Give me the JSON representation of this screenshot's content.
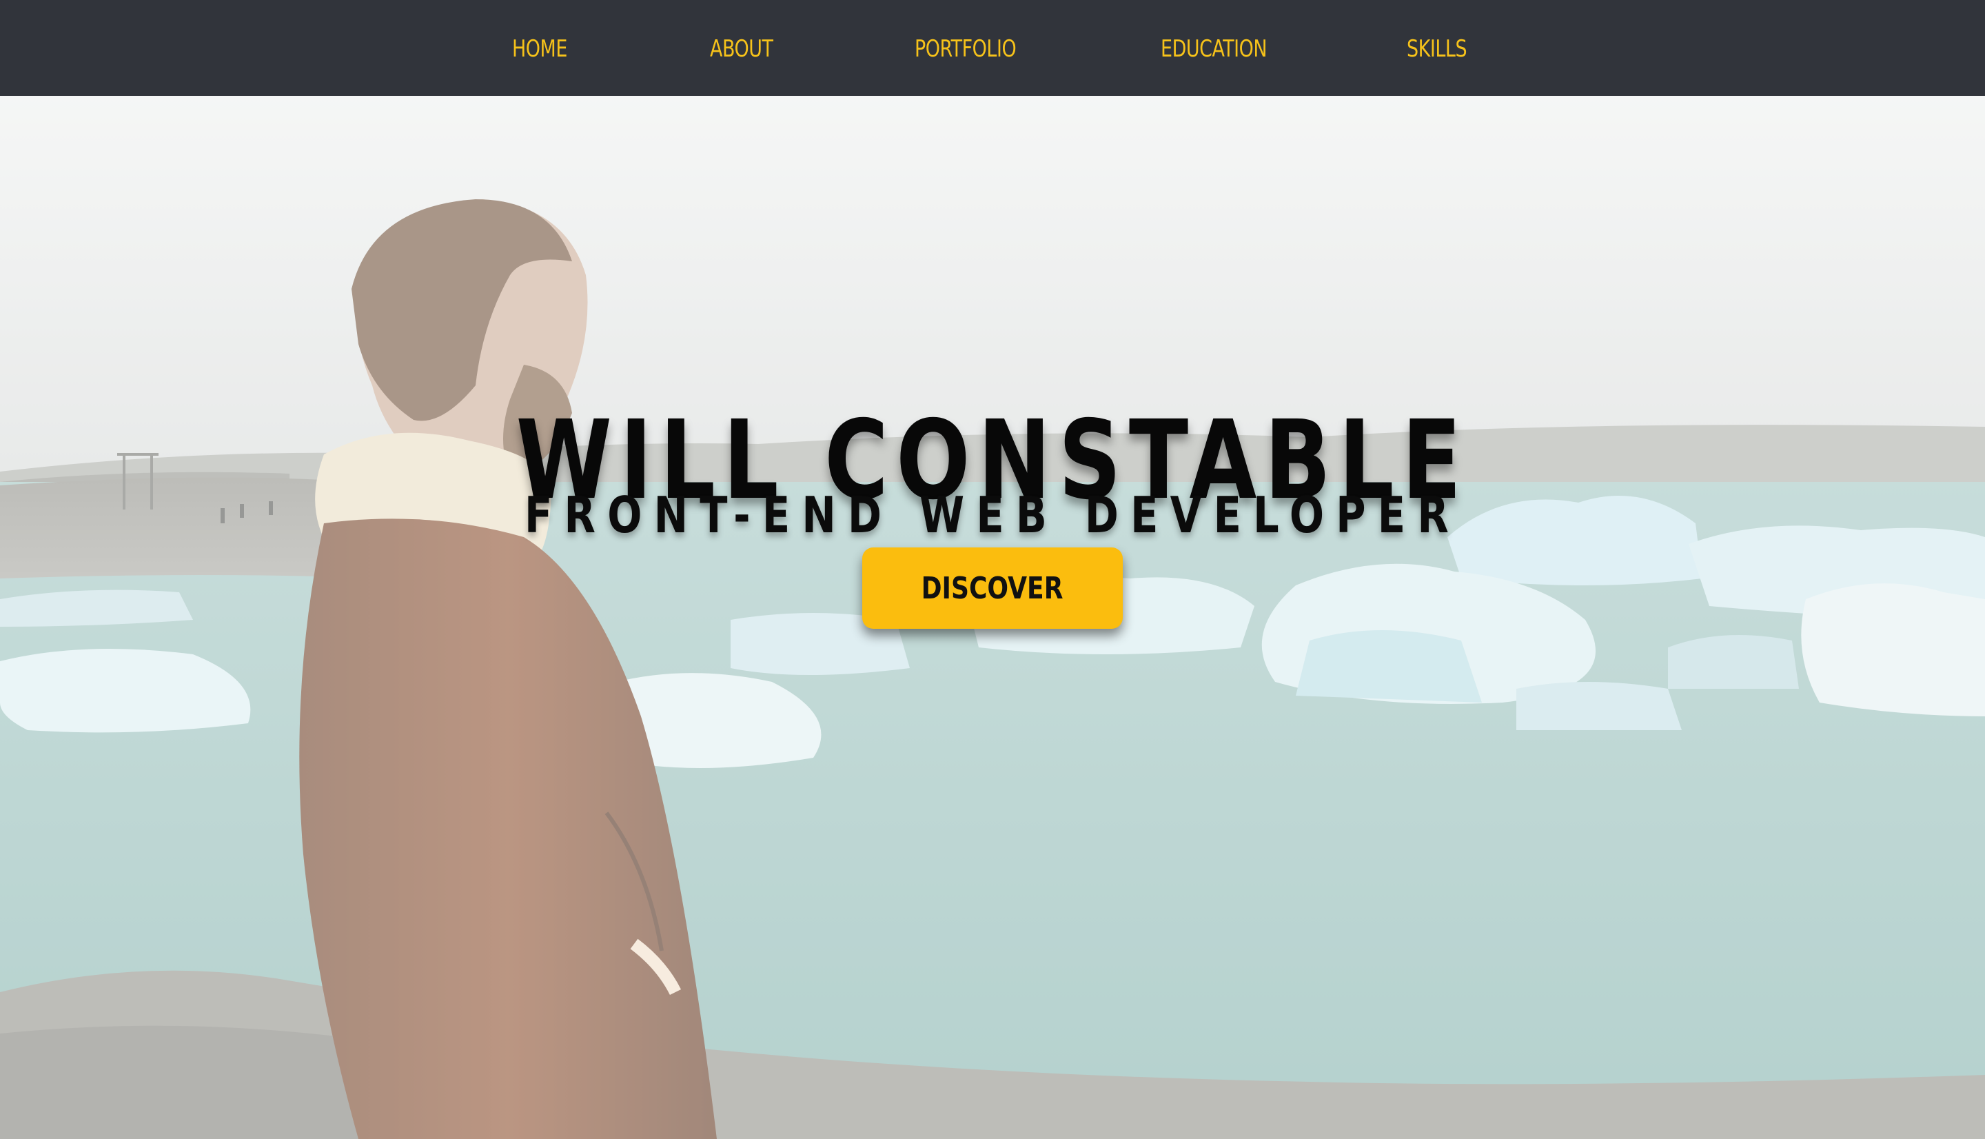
{
  "nav": {
    "items": [
      {
        "label": "HOME"
      },
      {
        "label": "ABOUT"
      },
      {
        "label": "PORTFOLIO"
      },
      {
        "label": "EDUCATION"
      },
      {
        "label": "SKILLS"
      }
    ]
  },
  "hero": {
    "title": "WILL CONSTABLE",
    "subtitle": "FRONT-END WEB DEVELOPER",
    "cta_label": "DISCOVER",
    "background_description": "person-in-brown-coat-looking-at-glacier-lagoon"
  },
  "colors": {
    "nav_background": "#31343b",
    "nav_text": "#f6c21a",
    "cta_background": "#fbbd0e",
    "title_text": "#080808"
  }
}
